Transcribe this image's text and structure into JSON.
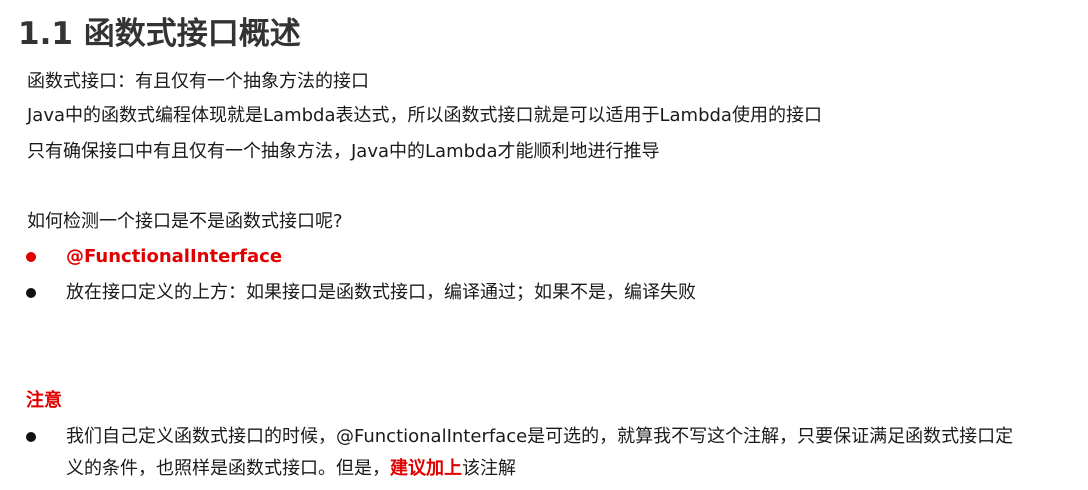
{
  "heading": "1.1 函数式接口概述",
  "paragraphs": [
    "函数式接口：有且仅有一个抽象方法的接口",
    "Java中的函数式编程体现就是Lambda表达式，所以函数式接口就是可以适用于Lambda使用的接口",
    "只有确保接口中有且仅有一个抽象方法，Java中的Lambda才能顺利地进行推导"
  ],
  "question": "如何检测一个接口是不是函数式接口呢?",
  "bullets": [
    {
      "text": "@FunctionalInterface",
      "style": "red-bold"
    },
    {
      "text": "放在接口定义的上方：如果接口是函数式接口，编译通过；如果不是，编译失败",
      "style": "normal"
    }
  ],
  "note": {
    "title": "注意",
    "line1": "我们自己定义函数式接口的时候，@FunctionalInterface是可选的，就算我不写这个注解，只要保证满足函数式接口定",
    "line2_prefix": "义的条件，也照样是函数式接口。但是，",
    "line2_emphasis": "建议加上",
    "line2_suffix": "该注解"
  },
  "colors": {
    "accent_red": "#e00000",
    "heading": "#333333",
    "text": "#1a1a1a"
  }
}
